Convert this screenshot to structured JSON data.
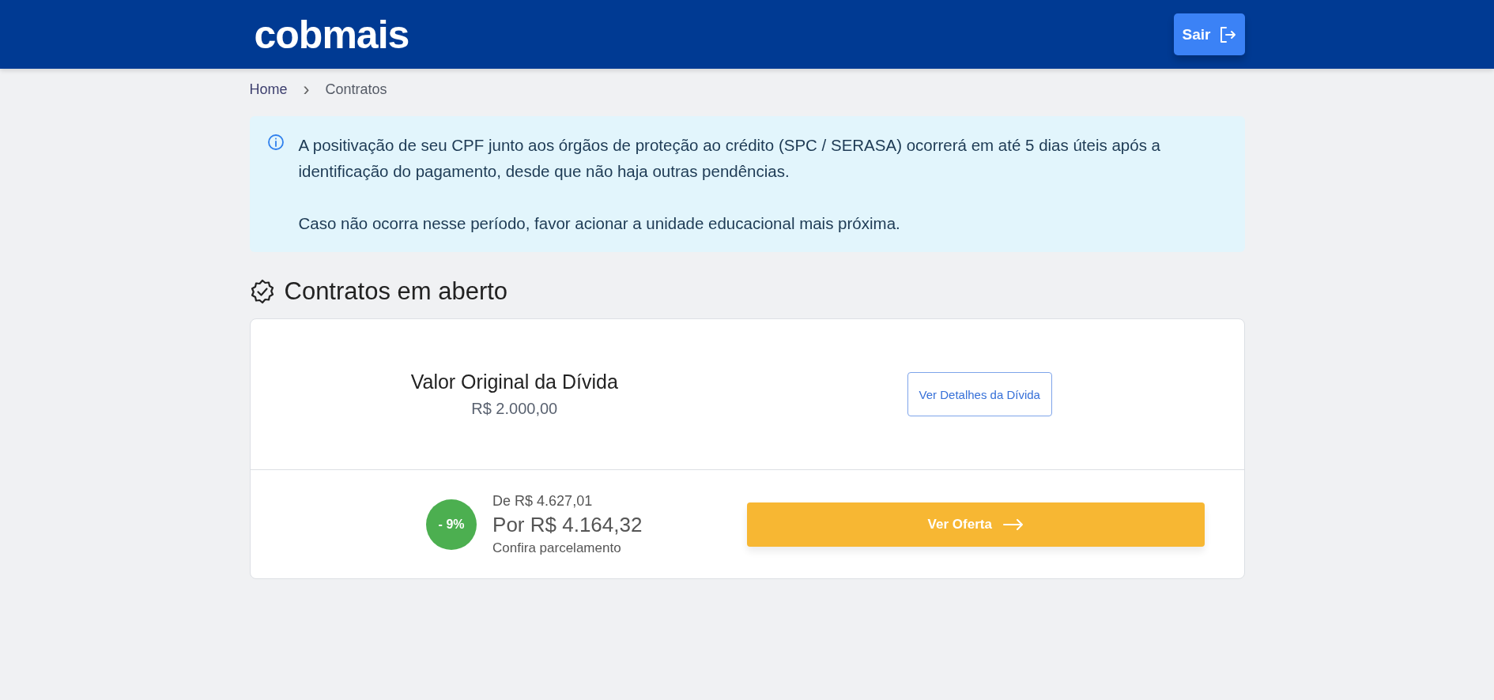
{
  "header": {
    "logo": "cobmais",
    "logout_button": "Sair"
  },
  "breadcrumb": [
    {
      "label": "Home",
      "selected": false
    },
    {
      "label": "Contratos",
      "selected": true
    }
  ],
  "breadcrumb_separator": "›",
  "notice": {
    "paragraphs": [
      "A positivação de seu CPF junto aos órgãos de proteção ao crédito (SPC / SERASA) ocorrerá em até 5 dias úteis após a identificação do pagamento, desde que não haja outras pendências.",
      "Caso não ocorra nesse período, favor acionar a unidade educacional mais próxima."
    ]
  },
  "section_title": "Contratos em aberto",
  "contracts": [
    {
      "label": "Valor Original da Dívida",
      "value": "R$ 2.000,00",
      "details_button": "Ver Detalhes da Dívida",
      "discount": "- 9%",
      "old_price": "De R$ 4.627,01",
      "new_price": "Por R$ 4.164,32",
      "installments_note": "Confira parcelamento",
      "offer_button": "Ver Oferta"
    }
  ]
}
